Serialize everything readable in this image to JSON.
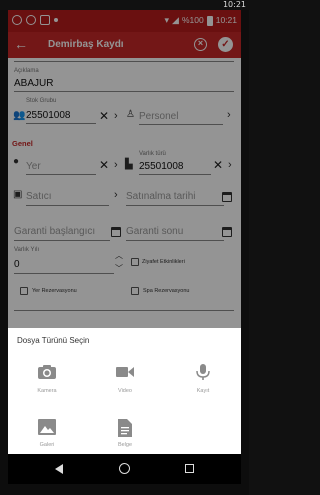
{
  "top_overlay": {
    "time": "10:21"
  },
  "status_bar": {
    "battery": "%100",
    "time": "10:21"
  },
  "app_bar": {
    "title": "Demirbaş Kaydı",
    "back_icon": "arrow-left-icon",
    "cancel_icon": "cancel-circle-icon",
    "ok_icon": "check-circle-icon"
  },
  "form": {
    "aciklama_label": "Açıklama",
    "aciklama_value": "ABAJUR",
    "stok_grubu_label": "Stok Grubu",
    "stok_grubu_value": "25501008",
    "personel_placeholder": "Personel",
    "section_genel": "Genel",
    "yer_placeholder": "Yer",
    "varlik_turu_label": "Varlık türü",
    "varlik_turu_value": "25501008",
    "satici_placeholder": "Satıcı",
    "satinalma_tarihi_placeholder": "Satınalma tarihi",
    "garanti_baslangici_placeholder": "Garanti başlangıcı",
    "garanti_sonu_placeholder": "Garanti sonu",
    "varlik_yili_label": "Varlık Yılı",
    "varlik_yili_value": "0",
    "ziyafet_label": "Ziyafet Etkinlikleri",
    "yer_rezervasyonu_label": "Yer Rezervasyonu",
    "spa_rezervasyonu_label": "Spa Rezervasyonu"
  },
  "sheet": {
    "title": "Dosya Türünü Seçin",
    "options": [
      {
        "label": "Kamera",
        "icon": "camera-icon"
      },
      {
        "label": "Video",
        "icon": "video-icon"
      },
      {
        "label": "Kayıt",
        "icon": "microphone-icon"
      },
      {
        "label": "Galeri",
        "icon": "image-icon"
      },
      {
        "label": "Belge",
        "icon": "document-icon"
      }
    ]
  },
  "colors": {
    "primary": "#c62828",
    "status": "#b71c1c"
  }
}
